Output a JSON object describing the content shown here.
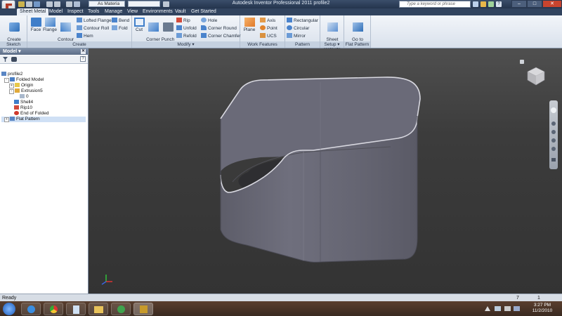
{
  "titlebar": {
    "title": "Autodesk Inventor Professional 2011    profile2",
    "material": "As Materia",
    "search_placeholder": "Type a keyword or phrase",
    "help": "?"
  },
  "tabs": [
    {
      "label": "Sheet Metal",
      "active": true
    },
    {
      "label": "Model"
    },
    {
      "label": "Inspect"
    },
    {
      "label": "Tools"
    },
    {
      "label": "Manage"
    },
    {
      "label": "View"
    },
    {
      "label": "Environments"
    },
    {
      "label": "Vault"
    },
    {
      "label": "Get Started"
    }
  ],
  "ribbon": {
    "sketch": {
      "create_2d_sketch": "Create\n2D Sketch",
      "panel": "Sketch"
    },
    "create": {
      "face": "Face",
      "flange": "Flange",
      "contour_flange": "Contour\nFlange",
      "lofted_flange": "Lofted Flange",
      "contour_roll": "Contour Roll",
      "hem": "Hem",
      "bend": "Bend",
      "fold": "Fold",
      "panel": "Create"
    },
    "modify": {
      "cut": "Cut",
      "corner_seam": "Corner\nSeam",
      "punch_tool": "Punch\nTool",
      "rip": "Rip",
      "unfold": "Unfold",
      "refold": "Refold",
      "hole": "Hole",
      "corner_round": "Corner Round",
      "corner_chamfer": "Corner Chamfer",
      "panel": "Modify ▾"
    },
    "work_features": {
      "plane": "Plane",
      "axis": "Axis",
      "point": "Point",
      "ucs": "UCS",
      "panel": "Work Features"
    },
    "pattern": {
      "rectangular": "Rectangular",
      "circular": "Circular",
      "mirror": "Mirror",
      "panel": "Pattern"
    },
    "setup": {
      "defaults": "Sheet Metal\nDefaults",
      "panel": "Setup ▾"
    },
    "flat_pattern": {
      "go_to": "Go to\nFlat Pattern",
      "panel": "Flat Pattern"
    }
  },
  "browser": {
    "header": "Model ▾",
    "tree": [
      "profile2",
      "Folded Model",
      "Origin",
      "Extrusion5",
      "0",
      "Shell4",
      "Rip10",
      "End of Folded",
      "Flat Pattern"
    ]
  },
  "status": {
    "text": "Ready",
    "num1": "7",
    "num2": "1"
  },
  "clock": {
    "time": "3:27 PM",
    "date": "11/2/2010"
  },
  "colors": {
    "ribbon_bg": "#dfe6ef",
    "titlebar": "#2b3c57",
    "viewport": "#3c3c3c",
    "model": "#6b6b77"
  }
}
